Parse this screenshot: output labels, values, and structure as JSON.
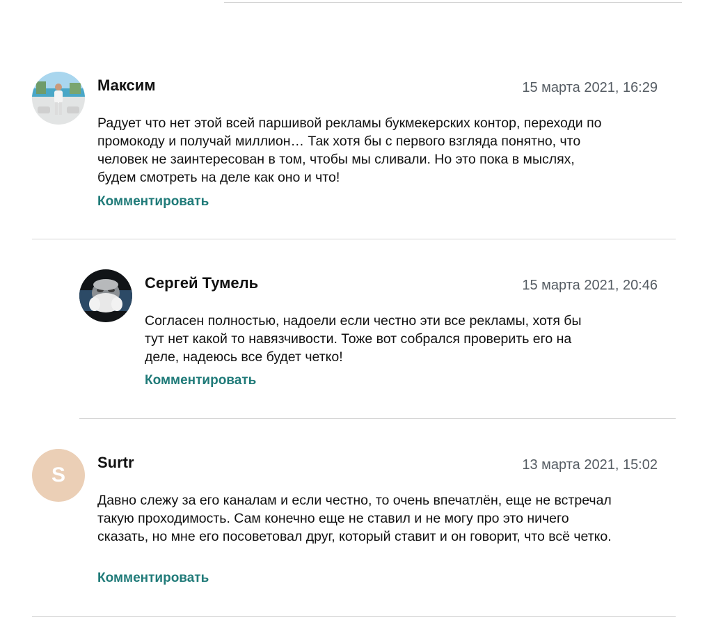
{
  "comments": [
    {
      "author": "Максим",
      "date": "15 марта 2021, 16:29",
      "text": "Радует что нет этой всей паршивой рекламы букмекерских контор, переходи по промокоду и получай миллион… Так хотя бы с первого взгляда понятно, что человек не заинтересован в том, чтобы мы сливали. Но это пока в мыслях, будем смотреть на деле как оно и что!",
      "reply_label": "Комментировать",
      "avatar_type": "photo"
    },
    {
      "author": "Сергей Тумель",
      "date": "15 марта 2021, 20:46",
      "text": "Согласен полностью, надоели если честно эти все рекламы, хотя бы тут нет какой то навязчивости. Тоже вот собрался проверить его на деле, надеюсь все будет четко!",
      "reply_label": "Комментировать",
      "avatar_type": "photo"
    },
    {
      "author": "Surtr",
      "date": "13 марта 2021, 15:02",
      "text": "Давно слежу за его каналам и если честно, то очень впечатлён, еще не встречал такую проходимость. Сам конечно еще не ставил и не могу про это ничего сказать, но мне его посоветовал друг, который ставит и он говорит, что всё четко.",
      "reply_label": "Комментировать",
      "avatar_letter": "S",
      "avatar_color": "#ebcfb6"
    }
  ],
  "colors": {
    "link": "#1f7a78",
    "date": "#555c63",
    "divider": "#d3d3d3"
  }
}
